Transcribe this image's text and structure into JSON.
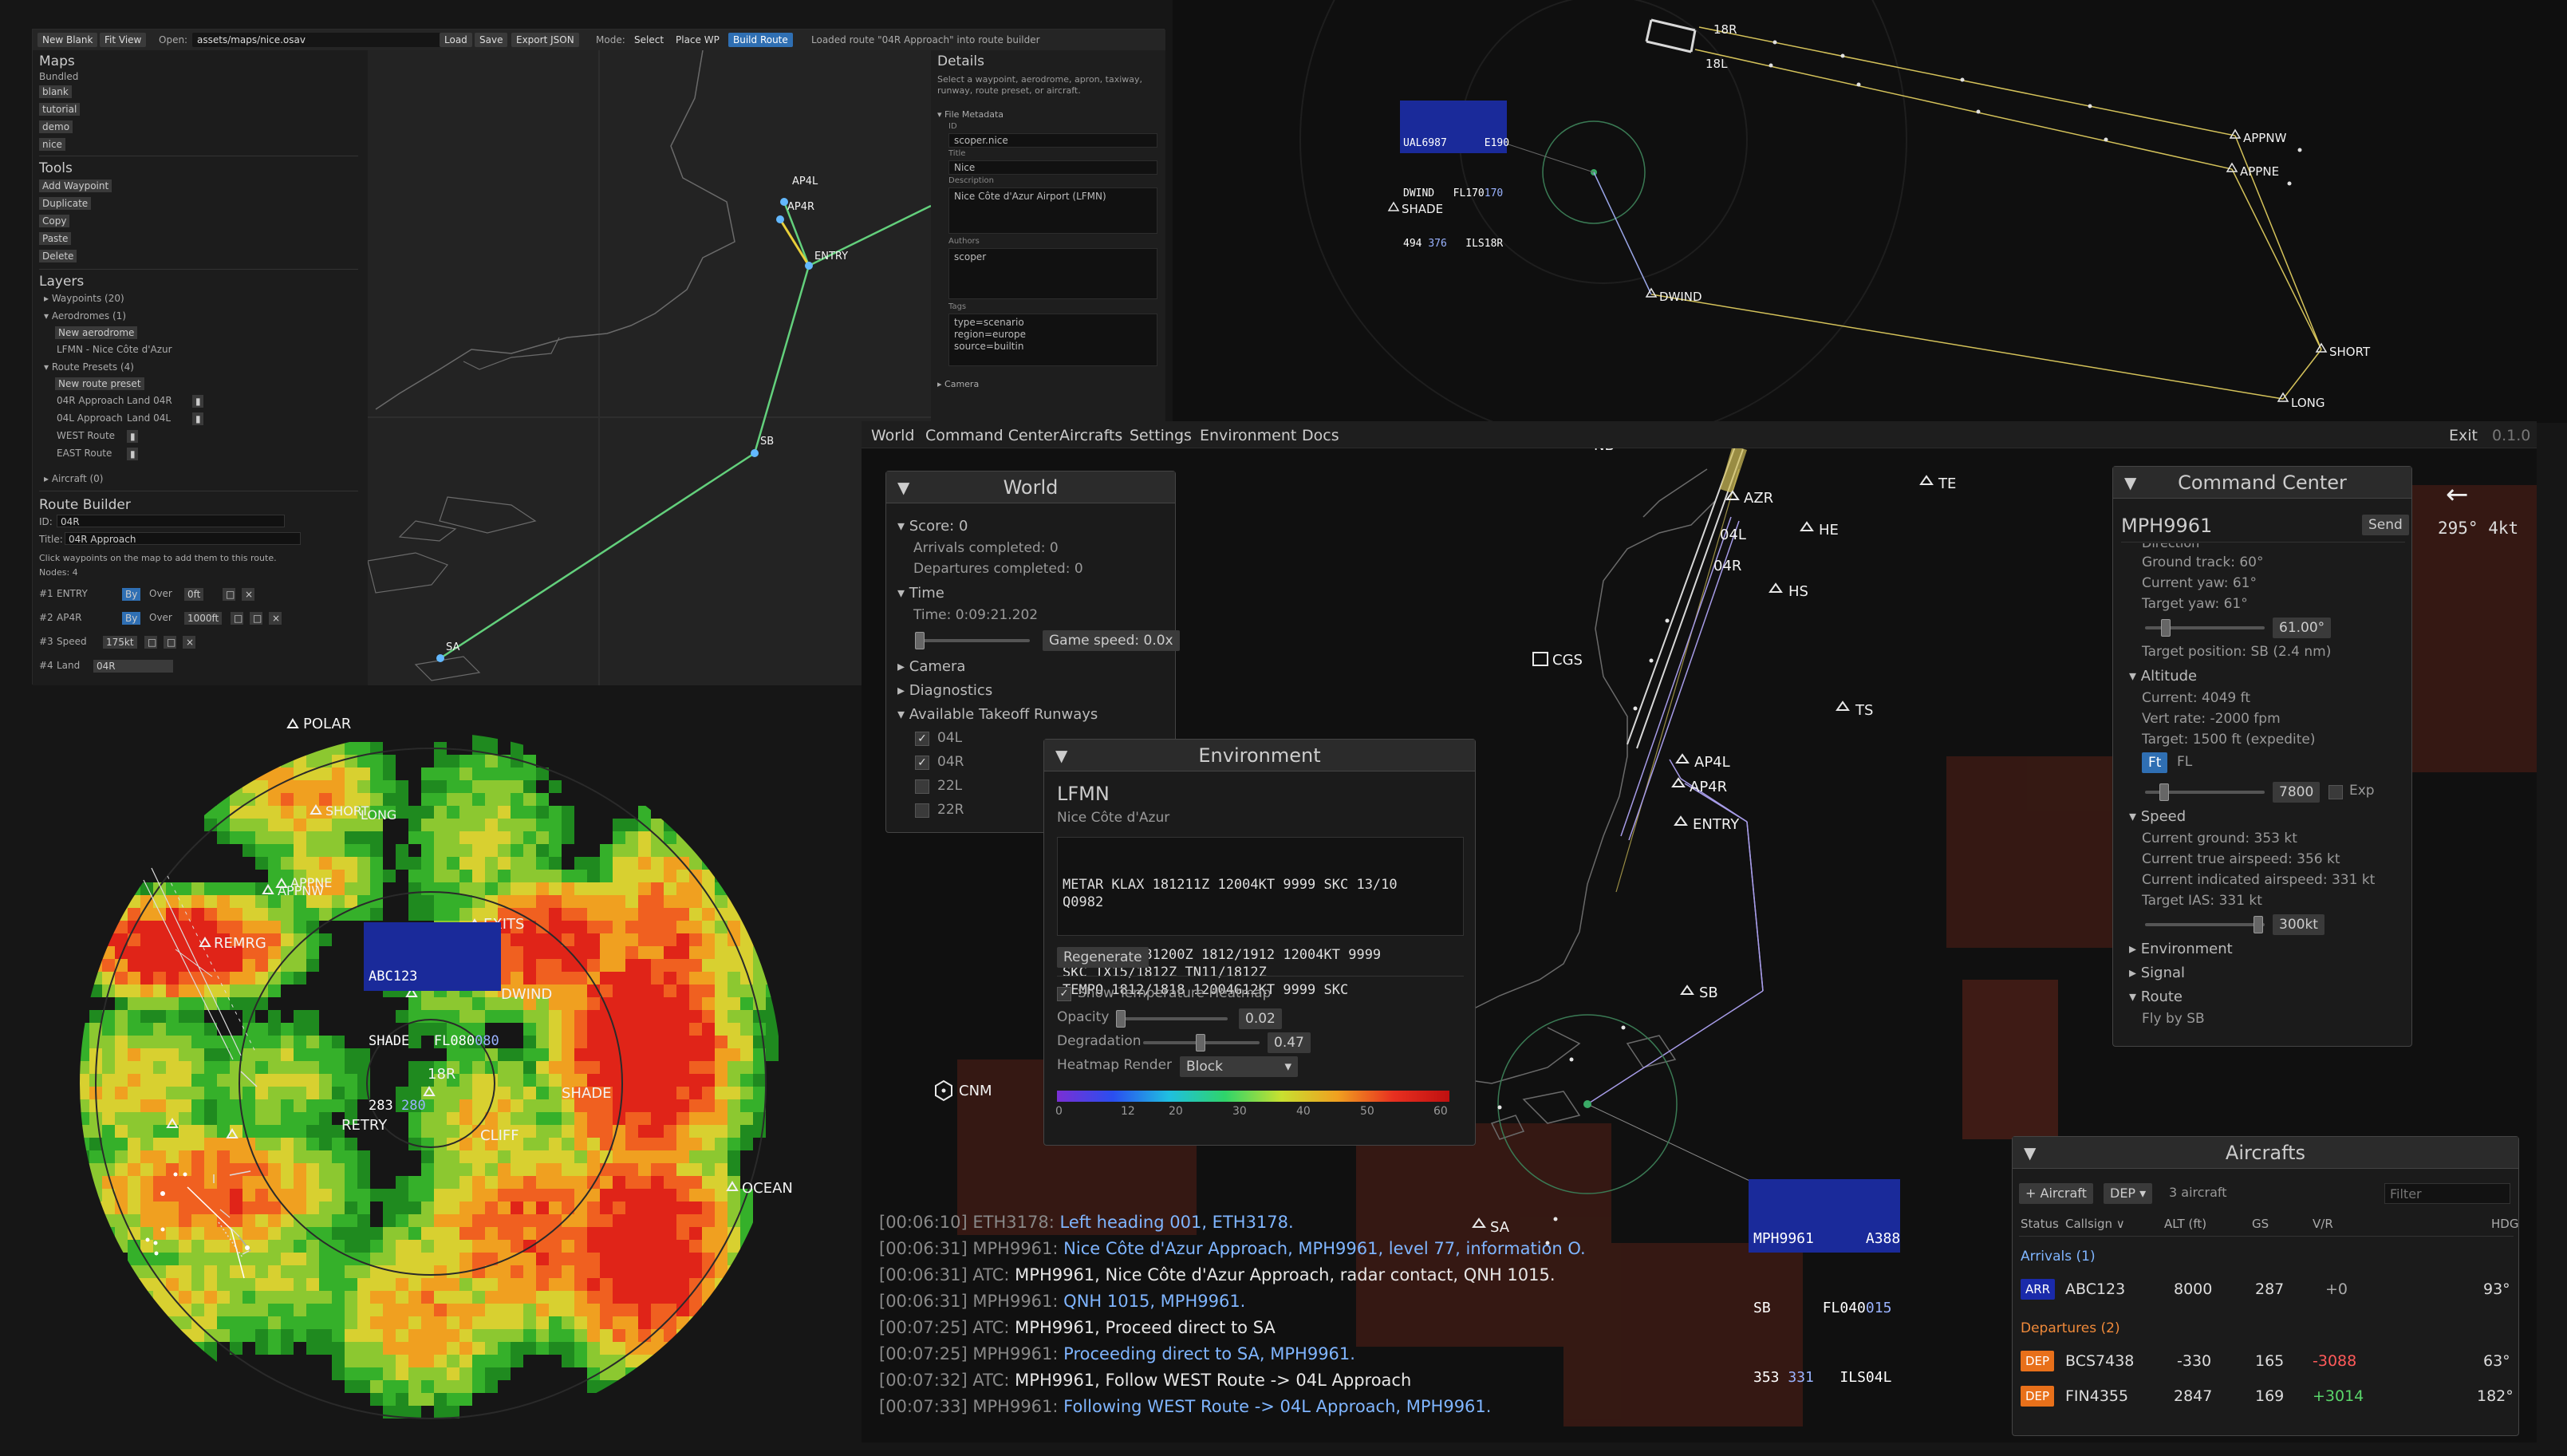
{
  "editor": {
    "toolbar": {
      "new_blank": "New Blank",
      "fit_view": "Fit View",
      "open_label": "Open:",
      "open_path": "assets/maps/nice.osav",
      "load": "Load",
      "save": "Save",
      "export_json": "Export JSON",
      "mode_label": "Mode:",
      "mode_select": "Select",
      "mode_place_wp": "Place WP",
      "mode_build_route": "Build Route",
      "status": "Loaded route \"04R Approach\" into route builder"
    },
    "left": {
      "maps_heading": "Maps",
      "bundled_label": "Bundled",
      "maps": [
        "blank",
        "tutorial",
        "demo",
        "nice"
      ],
      "tools_heading": "Tools",
      "tools": [
        "Add Waypoint",
        "Duplicate",
        "Copy",
        "Paste",
        "Delete"
      ],
      "layers_heading": "Layers",
      "waypoints": "▸ Waypoints (20)",
      "aerodromes": "▾ Aerodromes (1)",
      "new_aerodrome": "New aerodrome",
      "aerodrome_item": "LFMN - Nice Côte d'Azur",
      "route_presets": "▾ Route Presets (4)",
      "new_route_preset": "New route preset",
      "presets": [
        {
          "name": "04R Approach",
          "land": "Land 04R"
        },
        {
          "name": "04L Approach",
          "land": "Land 04L"
        },
        {
          "name": "WEST Route",
          "land": ""
        },
        {
          "name": "EAST Route",
          "land": ""
        }
      ],
      "aircraft": "▸ Aircraft (0)",
      "route_builder_heading": "Route Builder",
      "id_label": "ID:",
      "id_value": "04R",
      "title_label": "Title:",
      "title_value": "04R Approach",
      "hint": "Click waypoints on the map to add them to this route.",
      "nodes": "Nodes: 4",
      "rows": [
        {
          "num": "#1",
          "name": "ENTRY",
          "mode": "By",
          "over": "Over",
          "val": "0ft"
        },
        {
          "num": "#2",
          "name": "AP4R",
          "mode": "By",
          "over": "Over",
          "val": "1000ft"
        },
        {
          "num": "#3",
          "name": "Speed",
          "mode": "",
          "over": "",
          "val": "175kt"
        },
        {
          "num": "#4",
          "name": "Land",
          "mode": "",
          "over": "",
          "val": "04R"
        }
      ]
    },
    "map_labels": [
      "AP4L",
      "AP4R",
      "ENTRY",
      "SB",
      "SA"
    ],
    "right": {
      "details_heading": "Details",
      "details_hint": "Select a waypoint, aerodrome, apron, taxiway, runway, route preset, or aircraft.",
      "file_metadata": "▾ File Metadata",
      "id_label": "ID",
      "id_value": "scoper.nice",
      "title_label": "Title",
      "title_value": "Nice",
      "description_label": "Description",
      "description_value": "Nice Côte d'Azur Airport (LFMN)",
      "authors_label": "Authors",
      "authors_value": "scoper",
      "tags_label": "Tags",
      "tags_value": "type=scenario\nregion=europe\nsource=builtin",
      "camera": "▸ Camera"
    }
  },
  "radar_top": {
    "runway_labels": [
      "18R",
      "18L"
    ],
    "waypoints": [
      "APPNW",
      "APPNE",
      "SHORT",
      "LONG",
      "DWIND",
      "SHADE"
    ],
    "tag": {
      "line1": "UAL6987      E190",
      "line2": "DWIND   FL170",
      "line2_b": "170",
      "line3": "494",
      "line3_b": "376",
      "line3_c": "ILS18R"
    }
  },
  "main": {
    "menu": [
      "World",
      "Command Center",
      "Aircrafts",
      "Settings",
      "Environment",
      "Docs"
    ],
    "exit": "Exit",
    "version": "0.1.0",
    "wind": {
      "arrow": "←",
      "text": "295° 4kt"
    },
    "map_labels": [
      "NB",
      "AZR",
      "04L",
      "04R",
      "HE",
      "TE",
      "HS",
      "CGS",
      "TS",
      "AP4L",
      "AP4R",
      "ENTRY",
      "SB",
      "CNM",
      "SA"
    ],
    "tag": {
      "line1": "MPH9961      A388",
      "line2": "SB      FL040",
      "line2_b": "015",
      "line3": "353",
      "line3_b": "331",
      "line3_c": "ILS04L"
    },
    "world": {
      "title": "World",
      "score": "▾ Score: 0",
      "arrivals": "Arrivals completed: 0",
      "departures": "Departures completed: 0",
      "time_heading": "▾ Time",
      "time": "Time: 0:09:21.202",
      "game_speed": "Game speed: 0.0x",
      "camera": "▸ Camera",
      "diagnostics": "▸ Diagnostics",
      "runways_heading": "▾ Available Takeoff Runways",
      "runways": [
        {
          "name": "04L",
          "checked": "✓"
        },
        {
          "name": "04R",
          "checked": "✓"
        },
        {
          "name": "22L",
          "checked": ""
        },
        {
          "name": "22R",
          "checked": ""
        }
      ]
    },
    "environment": {
      "title": "Environment",
      "icao": "LFMN",
      "name": "Nice Côte d'Azur",
      "metar": "METAR KLAX 181211Z 12004KT 9999 SKC 13/10\nQ0982",
      "taf": "TAF KLAX 181200Z 1812/1912 12004KT 9999\nSKC TX15/1812Z TN11/1812Z\nTEMPO 1812/1818 12004G12KT 9999 SKC",
      "regenerate": "Regenerate",
      "heatmap_toggle": "Show Temperature Heatmap",
      "opacity_label": "Opacity",
      "opacity_value": "0.02",
      "degradation_label": "Degradation",
      "degradation_value": "0.47",
      "render_label": "Heatmap Render",
      "render_value": "Block",
      "scale_ticks": [
        "0",
        "12",
        "20",
        "30",
        "40",
        "50",
        "60"
      ]
    },
    "command_center": {
      "title": "Command Center",
      "callsign": "MPH9961",
      "send": "Send",
      "direction_cut": "Direction",
      "ground_track": "Ground track: 60°",
      "current_yaw": "Current yaw: 61°",
      "target_yaw": "Target yaw: 61°",
      "yaw_value": "61.00°",
      "target_position": "Target position: SB (2.4 nm)",
      "altitude_heading": "▾ Altitude",
      "alt_current": "Current: 4049 ft",
      "vert_rate": "Vert rate: -2000 fpm",
      "alt_target": "Target: 1500 ft (expedite)",
      "ft": "Ft",
      "fl": "FL",
      "alt_value": "7800",
      "exp": "Exp",
      "speed_heading": "▾ Speed",
      "ground_speed": "Current ground: 353 kt",
      "tas": "Current true airspeed: 356 kt",
      "ias": "Current indicated airspeed: 331 kt",
      "target_ias": "Target IAS: 331 kt",
      "speed_value": "300kt",
      "environment": "▸ Environment",
      "signal": "▸ Signal",
      "route": "▾ Route",
      "fly_by": "Fly by SB"
    },
    "aircrafts": {
      "title": "Aircrafts",
      "add": "+ Aircraft",
      "filter_dep": "DEP",
      "count": "3 aircraft",
      "filter_placeholder": "Filter",
      "columns": [
        "Status",
        "Callsign ∨",
        "ALT (ft)",
        "GS",
        "V/R",
        "HDG"
      ],
      "arrivals_heading": "Arrivals (1)",
      "arrivals": [
        {
          "status": "ARR",
          "callsign": "ABC123",
          "alt": "8000",
          "gs": "287",
          "vr": "+0",
          "hdg": "93°"
        }
      ],
      "departures_heading": "Departures (2)",
      "departures": [
        {
          "status": "DEP",
          "callsign": "BCS7438",
          "alt": "-330",
          "gs": "165",
          "vr": "-3088",
          "hdg": "63°"
        },
        {
          "status": "DEP",
          "callsign": "FIN4355",
          "alt": "2847",
          "gs": "169",
          "vr": "+3014",
          "hdg": "182°"
        }
      ]
    },
    "log": [
      {
        "t": "[00:06:10]",
        "who": "ETH3178:",
        "msg": "Left heading 001, ETH3178.",
        "c": "lb"
      },
      {
        "t": "[00:06:31]",
        "who": "MPH9961:",
        "msg": "Nice Côte d'Azur Approach, MPH9961, level 77, information O.",
        "c": "lb"
      },
      {
        "t": "[00:06:31]",
        "who": "ATC:",
        "msg": "MPH9961, Nice Côte d'Azur Approach, radar contact, QNH 1015.",
        "c": "lw"
      },
      {
        "t": "[00:06:31]",
        "who": "MPH9961:",
        "msg": "QNH 1015, MPH9961.",
        "c": "lb"
      },
      {
        "t": "[00:07:25]",
        "who": "ATC:",
        "msg": "MPH9961, Proceed direct to SA",
        "c": "lw"
      },
      {
        "t": "[00:07:25]",
        "who": "MPH9961:",
        "msg": "Proceeding direct to SA, MPH9961.",
        "c": "lb"
      },
      {
        "t": "[00:07:32]",
        "who": "ATC:",
        "msg": "MPH9961, Follow WEST Route -> 04L Approach",
        "c": "lw"
      },
      {
        "t": "[00:07:33]",
        "who": "MPH9961:",
        "msg": "Following WEST Route -> 04L Approach, MPH9961.",
        "c": "lb"
      }
    ]
  },
  "heatmap": {
    "waypoints": [
      "POLAR",
      "SHORT",
      "LONG",
      "APPNE",
      "APPNW",
      "REMRG",
      "EXITS",
      "DWIND",
      "18R",
      "SHADE",
      "RETRY",
      "CLIFF",
      "OCEAN"
    ],
    "tag": {
      "line1": "ABC123",
      "line2": "SHADE   FL080",
      "line2_b": "080",
      "line3": "283",
      "line3_b": "280"
    }
  }
}
